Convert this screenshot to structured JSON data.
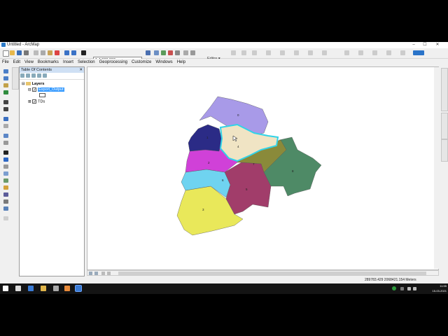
{
  "window": {
    "title": "Untitled - ArcMap",
    "minimize": "–",
    "maximize": "☐",
    "close": "✕"
  },
  "menu": [
    "File",
    "Edit",
    "View",
    "Bookmarks",
    "Insert",
    "Selection",
    "Geoprocessing",
    "Customize",
    "Windows",
    "Help"
  ],
  "toolbar": {
    "scale_value": "1:4,000,000",
    "editor_label": "Editor ▾"
  },
  "toc": {
    "title": "Table Of Contents",
    "root": "Layers",
    "layers": [
      {
        "name": "Export_Output",
        "checked": true,
        "selected": true
      },
      {
        "name": "TDs",
        "checked": true,
        "selected": false
      }
    ]
  },
  "map": {
    "region_labels": [
      "0",
      "1",
      "4",
      "2",
      "7",
      "6",
      "8",
      "3",
      "5",
      "8"
    ],
    "colors": {
      "north": "#a89ae8",
      "northwest": "#2b2b86",
      "selected": "#f0e4c4",
      "highlight": "#31d3e8",
      "center_olive": "#8a8a3a",
      "east_green": "#4e8a66",
      "magenta": "#d041d8",
      "light_blue": "#6fd3f0",
      "maroon": "#a13d6a",
      "yellow": "#e9e85a"
    }
  },
  "right_tabs": [
    "Create Features",
    "Catalog",
    "Search"
  ],
  "left_vtab": "ArcToolbox",
  "status": {
    "coordinates": "289783.429  2068421.154 Meters"
  },
  "taskbar": {
    "time": "11:55",
    "date": "15-03-2021"
  }
}
